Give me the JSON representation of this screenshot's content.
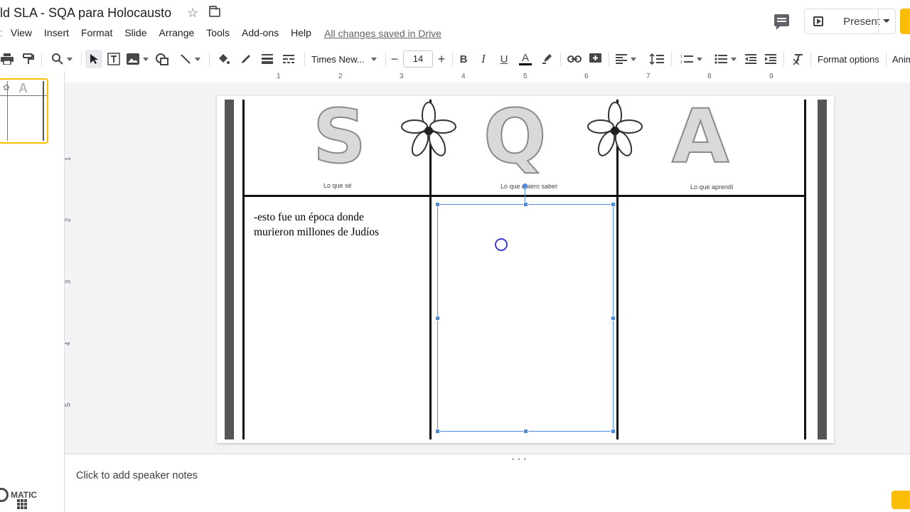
{
  "title": "ld SLA - SQA para Holocausto",
  "menu": {
    "lead": "ː",
    "items": [
      "View",
      "Insert",
      "Format",
      "Slide",
      "Arrange",
      "Tools",
      "Add-ons",
      "Help"
    ]
  },
  "saved_status": "All changes saved in Drive",
  "present": {
    "label": "Present"
  },
  "toolbar": {
    "font_name": "Times New...",
    "font_size": "14",
    "format_options": "Format options",
    "animate": "Anim",
    "bold": "B",
    "italic": "I",
    "underline": "U",
    "text_color": "A"
  },
  "ruler": {
    "h": [
      "1",
      "2",
      "3",
      "4",
      "5",
      "6",
      "7",
      "8",
      "9"
    ],
    "v": [
      "1",
      "2",
      "3",
      "4",
      "5"
    ]
  },
  "slide": {
    "letters": [
      "S",
      "Q",
      "A"
    ],
    "captions": [
      "Lo que sé",
      "Lo que quiero saber",
      "Lo que aprendí"
    ],
    "body_text_1": "-esto fue un época donde",
    "body_text_2": "murieron millones de Judíos"
  },
  "thumbnail": {
    "letter": "A"
  },
  "speaker_notes_placeholder": "Click to add speaker notes",
  "watermark": "MATIC",
  "colors": {
    "accent": "#fbbc04",
    "selection": "#4a89dc"
  }
}
